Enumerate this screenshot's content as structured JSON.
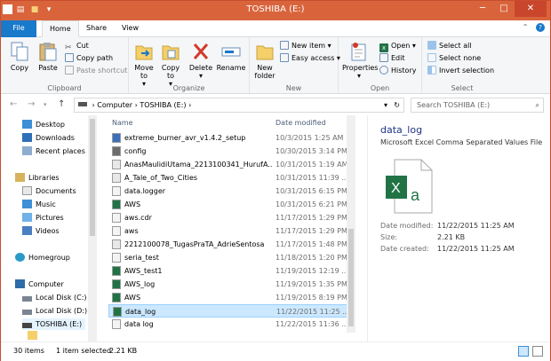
{
  "window": {
    "title": "TOSHIBA (E:)"
  },
  "tabs": {
    "file": "File",
    "home": "Home",
    "share": "Share",
    "view": "View"
  },
  "ribbon": {
    "clipboard": {
      "label": "Clipboard",
      "copy": "Copy",
      "paste": "Paste",
      "cut": "Cut",
      "copy_path": "Copy path",
      "paste_shortcut": "Paste shortcut"
    },
    "organize": {
      "label": "Organize",
      "move_to": "Move to",
      "copy_to": "Copy to",
      "delete": "Delete",
      "rename": "Rename"
    },
    "new": {
      "label": "New",
      "new_folder": "New folder",
      "new_item": "New item",
      "easy_access": "Easy access"
    },
    "open": {
      "label": "Open",
      "properties": "Properties",
      "open": "Open",
      "edit": "Edit",
      "history": "History"
    },
    "select": {
      "label": "Select",
      "select_all": "Select all",
      "select_none": "Select none",
      "invert": "Invert selection"
    }
  },
  "address": {
    "computer": "Computer",
    "drive": "TOSHIBA (E:)",
    "search_placeholder": "Search TOSHIBA (E:)"
  },
  "nav": [
    {
      "label": "Desktop",
      "icon": "desktop-icon"
    },
    {
      "label": "Downloads",
      "icon": "downloads-icon"
    },
    {
      "label": "Recent places",
      "icon": "recent-places-icon"
    },
    {
      "label": "Libraries",
      "icon": "libraries-icon"
    },
    {
      "label": "Documents",
      "icon": "documents-icon"
    },
    {
      "label": "Music",
      "icon": "music-icon"
    },
    {
      "label": "Pictures",
      "icon": "pictures-icon"
    },
    {
      "label": "Videos",
      "icon": "videos-icon"
    },
    {
      "label": "Homegroup",
      "icon": "homegroup-icon"
    },
    {
      "label": "Computer",
      "icon": "computer-icon"
    },
    {
      "label": "Local Disk (C:)",
      "icon": "drive-icon"
    },
    {
      "label": "Local Disk (D:)",
      "icon": "drive-icon"
    },
    {
      "label": "TOSHIBA (E:)",
      "icon": "drive-icon"
    }
  ],
  "columns": {
    "name": "Name",
    "date": "Date modified"
  },
  "files": [
    {
      "name": "extreme_burner_avr_v1.4.2_setup",
      "date": "10/3/2015 1:25 AM",
      "icon": "setup-icon"
    },
    {
      "name": "config",
      "date": "10/30/2015 3:14 PM",
      "icon": "config-icon"
    },
    {
      "name": "AnasMaulidiUtama_2213100341_HurufA....",
      "date": "10/31/2015 1:19 AM",
      "icon": "document-icon"
    },
    {
      "name": "A_Tale_of_Two_Cities",
      "date": "10/31/2015 11:39 ...",
      "icon": "document-icon"
    },
    {
      "name": "data.logger",
      "date": "10/31/2015 6:15 PM",
      "icon": "file-icon"
    },
    {
      "name": "AWS",
      "date": "10/31/2015 6:21 PM",
      "icon": "excel-icon"
    },
    {
      "name": "aws.cdr",
      "date": "11/17/2015 1:29 PM",
      "icon": "file-icon"
    },
    {
      "name": "aws",
      "date": "11/17/2015 1:29 PM",
      "icon": "file-icon"
    },
    {
      "name": "2212100078_TugasPraTA_AdrieSentosa",
      "date": "11/17/2015 1:48 PM",
      "icon": "document-icon"
    },
    {
      "name": "seria_test",
      "date": "11/18/2015 1:20 PM",
      "icon": "file-icon"
    },
    {
      "name": "AWS_test1",
      "date": "11/19/2015 12:19 ...",
      "icon": "excel-icon"
    },
    {
      "name": "AWS_log",
      "date": "11/19/2015 1:35 PM",
      "icon": "excel-icon"
    },
    {
      "name": "AWS",
      "date": "11/19/2015 8:19 PM",
      "icon": "excel-icon"
    },
    {
      "name": "data_log",
      "date": "11/22/2015 11:25 ...",
      "icon": "excel-icon",
      "selected": true
    },
    {
      "name": "data log",
      "date": "11/22/2015 11:36 ...",
      "icon": "file-icon"
    }
  ],
  "preview": {
    "title": "data_log",
    "type": "Microsoft Excel Comma Separated Values File",
    "date_modified_label": "Date modified:",
    "date_modified": "11/22/2015 11:25 AM",
    "size_label": "Size:",
    "size": "2.21 KB",
    "date_created_label": "Date created:",
    "date_created": "11/22/2015 11:25 AM"
  },
  "status": {
    "items": "30 items",
    "selected": "1 item selected",
    "size": "2.21 KB"
  },
  "colors": {
    "titlebar": "#d9643c",
    "file_tab": "#1979ca",
    "selection": "#cce8ff",
    "excel": "#217346"
  }
}
